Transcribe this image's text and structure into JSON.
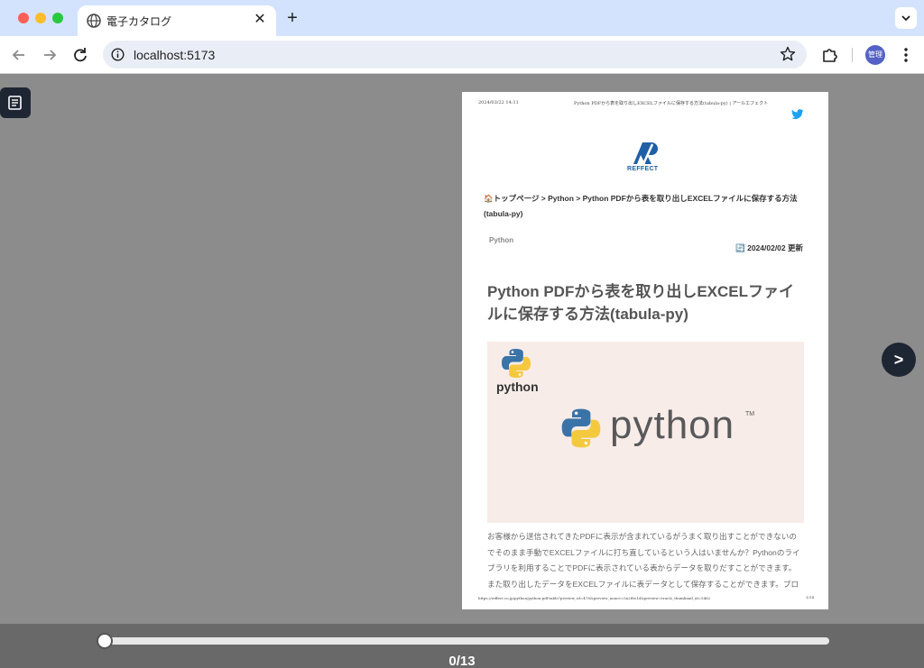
{
  "browser": {
    "tab_title": "電子カタログ",
    "tab_close": "✕",
    "new_tab": "+",
    "url": "localhost:5173",
    "profile_label": "管理"
  },
  "viewer": {
    "next_label": ">",
    "page_current": 0,
    "page_total": 13,
    "page_counter": "0/13"
  },
  "page": {
    "print_date": "2024/03/22 14:11",
    "print_header": "Python PDFから表を取り出しEXCELファイルに保存する方法(tabula-py) | アールエフェクト",
    "logo_text": "REFFECT",
    "breadcrumb": {
      "home": "🏠",
      "text": "トップページ > Python > Python PDFから表を取り出しEXCELファイルに保存する方法(tabula-py)"
    },
    "category": "Python",
    "updated_icon": "🔄",
    "updated": "2024/02/02 更新",
    "title": "Python PDFから表を取り出しEXCELファイルに保存する方法(tabula-py)",
    "hero_small_text": "python",
    "hero_big_text": "python",
    "hero_tm": "TM",
    "body_lines": [
      "お客様から送信されてきたPDFに表示が含まれているがうまく取り出すことができないの",
      "でそのまま手動でEXCELファイルに打ち直しているという人はいませんか？Pythonのライ",
      "ブラリを利用することでPDFに表示されている表からデータを取りだすことができます。",
      "また取り出したデータをEXCELファイルに表データとして保存することができます。プロ"
    ],
    "footer_url": "https://reffect.co.jp/python/python-pdf-table?preview_id=478&preview_nonce=5a2f8e1d&preview=true&_thumbnail_id=5462",
    "footer_page": "1/14"
  },
  "colors": {
    "viewer_bg": "#8c8c8c",
    "bottom_bar": "#696969",
    "dark_button": "#1e2533",
    "accent_orange": "#e07a2e",
    "brand_blue": "#1f5fa6"
  },
  "icons": {
    "tab_favicon": "globe-icon",
    "back": "arrow-left-icon",
    "forward": "arrow-right-icon",
    "reload": "reload-icon",
    "site_info": "info-icon",
    "bookmark": "star-icon",
    "extensions": "puzzle-icon",
    "menu": "kebab-menu-icon",
    "toc": "document-list-icon",
    "social": "twitter-icon"
  }
}
